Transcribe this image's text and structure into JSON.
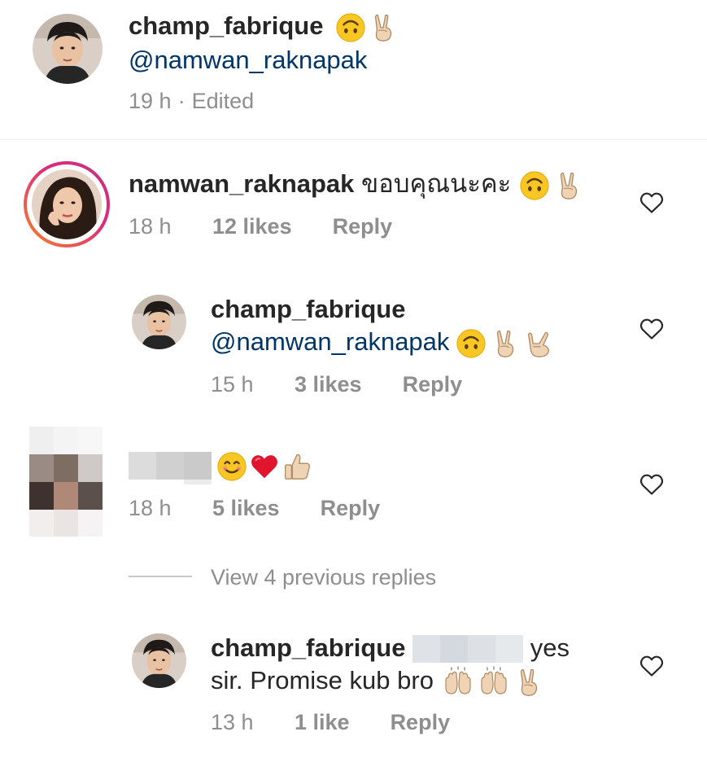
{
  "caption": {
    "username": "champ_fabrique",
    "mention": "@namwan_raknapak",
    "time": "19 h",
    "sep": "·",
    "edited": "Edited"
  },
  "comments": [
    {
      "username": "namwan_raknapak",
      "text": "ขอบคุณนะคะ",
      "time": "18 h",
      "likes": "12 likes",
      "reply": "Reply"
    },
    {
      "username": "champ_fabrique",
      "mention": "@namwan_raknapak",
      "time": "15 h",
      "likes": "3 likes",
      "reply": "Reply"
    },
    {
      "username": "",
      "time": "18 h",
      "likes": "5 likes",
      "reply": "Reply"
    },
    {
      "username": "champ_fabrique",
      "text_a": "yes",
      "text_b": "sir. Promise kub bro",
      "time": "13 h",
      "likes": "1 like",
      "reply": "Reply"
    }
  ],
  "view_previous": "View 4 previous replies",
  "colors": {
    "username": "#262626",
    "mention": "#003569",
    "meta": "#8e8e8e",
    "story_ring_start": "#f58529",
    "story_ring_end": "#dd2a7b",
    "heart_red": "#ed4956"
  },
  "icons": [
    "heart-icon",
    "upside-down-face-emoji",
    "victory-hand-emoji",
    "love-you-hand-emoji",
    "smiling-face-emoji",
    "red-heart-emoji",
    "thumbs-up-emoji",
    "raising-hands-emoji"
  ]
}
